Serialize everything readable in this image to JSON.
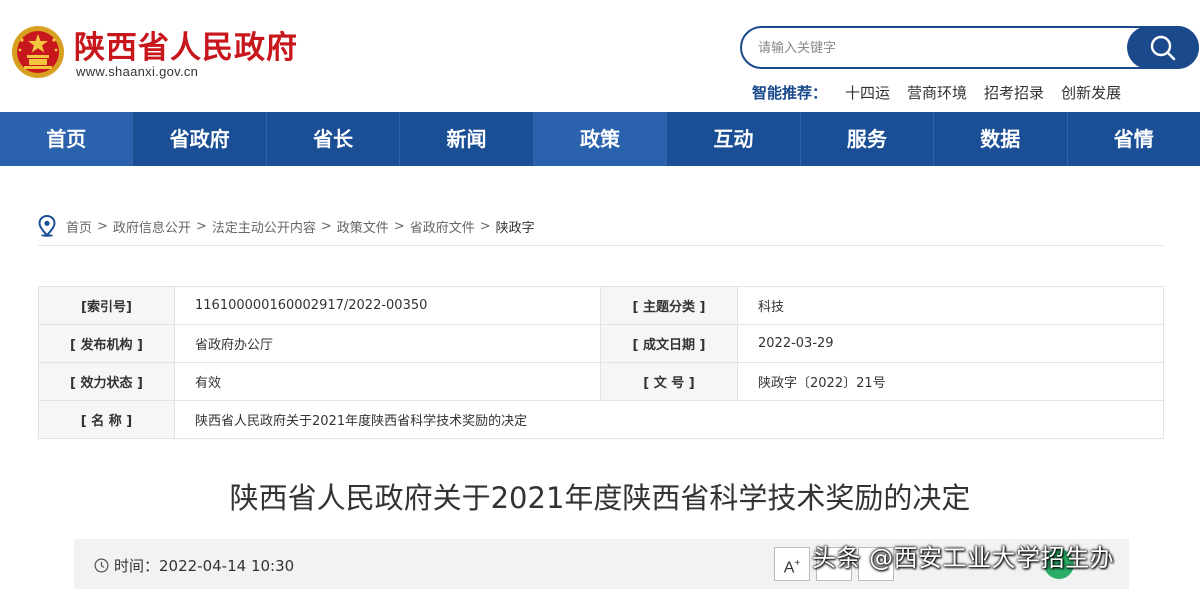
{
  "header": {
    "site_title": "陕西省人民政府",
    "site_url": "www.shaanxi.gov.cn",
    "search_placeholder": "请输入关键字",
    "recommend_label": "智能推荐：",
    "recommend_items": [
      "十四运",
      "营商环境",
      "招考招录",
      "创新发展"
    ]
  },
  "nav": {
    "items": [
      "首页",
      "省政府",
      "省长",
      "新闻",
      "政策",
      "互动",
      "服务",
      "数据",
      "省情"
    ],
    "active": "政策"
  },
  "breadcrumb": [
    "首页",
    "政府信息公开",
    "法定主动公开内容",
    "政策文件",
    "省政府文件",
    "陕政字"
  ],
  "breadcrumb_sep": ">",
  "meta": {
    "index_label": "[索引号]",
    "index_value": "116100000160002917/2022-00350",
    "topic_label": "[ 主题分类 ]",
    "topic_value": "科技",
    "issuer_label": "[ 发布机构 ]",
    "issuer_value": "省政府办公厅",
    "date_label": "[ 成文日期 ]",
    "date_value": "2022-03-29",
    "status_label": "[ 效力状态 ]",
    "status_value": "有效",
    "docno_label": "[ 文 号 ]",
    "docno_value": "陕政字〔2022〕21号",
    "name_label": "[ 名 称 ]",
    "name_value": "陕西省人民政府关于2021年度陕西省科学技术奖励的决定"
  },
  "doc_title": "陕西省人民政府关于2021年度陕西省科学技术奖励的决定",
  "info": {
    "time_text": "时间：2022-04-14 10:30",
    "font_increase": "A"
  },
  "watermark": "头条 @西安工业大学招生办",
  "colors": {
    "brand_red": "#c8161d",
    "nav_blue": "#1a4f96",
    "nav_active": "#2a62ad",
    "search_blue": "#1a4a8c"
  }
}
